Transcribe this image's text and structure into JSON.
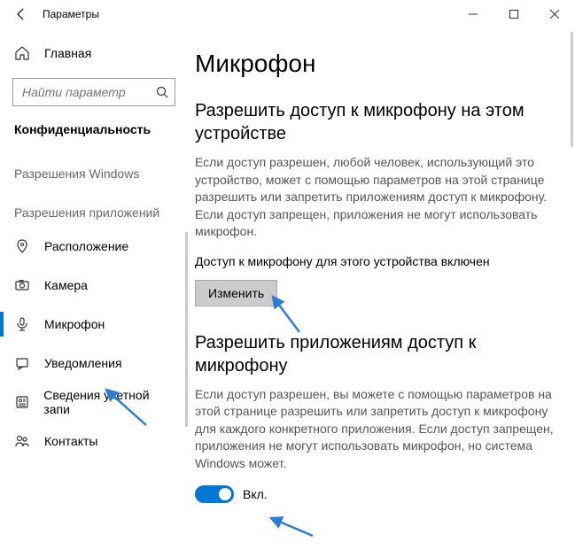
{
  "titlebar": {
    "title": "Параметры"
  },
  "sidebar": {
    "home_label": "Главная",
    "search_placeholder": "Найти параметр",
    "section": "Конфиденциальность",
    "group1": "Разрешения Windows",
    "group2": "Разрешения приложений",
    "items": [
      {
        "icon": "location",
        "label": "Расположение"
      },
      {
        "icon": "camera",
        "label": "Камера"
      },
      {
        "icon": "microphone",
        "label": "Микрофон"
      },
      {
        "icon": "notifications",
        "label": "Уведомления"
      },
      {
        "icon": "account",
        "label": "Сведения учетной запи"
      },
      {
        "icon": "contacts",
        "label": "Контакты"
      }
    ]
  },
  "content": {
    "heading": "Микрофон",
    "sec1_title": "Разрешить доступ к микрофону на этом устройстве",
    "sec1_body": "Если доступ разрешен, любой человек, использующий это устройство, может с помощью параметров на этой странице разрешить или запретить приложениям доступ к микрофону. Если доступ запрещен, приложения не могут использовать микрофон.",
    "sec1_status": "Доступ к микрофону для этого устройства включен",
    "change_btn": "Изменить",
    "sec2_title": "Разрешить приложениям доступ к микрофону",
    "sec2_body": "Если доступ разрешен, вы можете с помощью параметров на этой странице разрешить или запретить доступ к микрофону для каждого конкретного приложения. Если доступ запрещен, приложения не могут использовать микрофон, но система Windows может.",
    "toggle_label": "Вкл."
  }
}
